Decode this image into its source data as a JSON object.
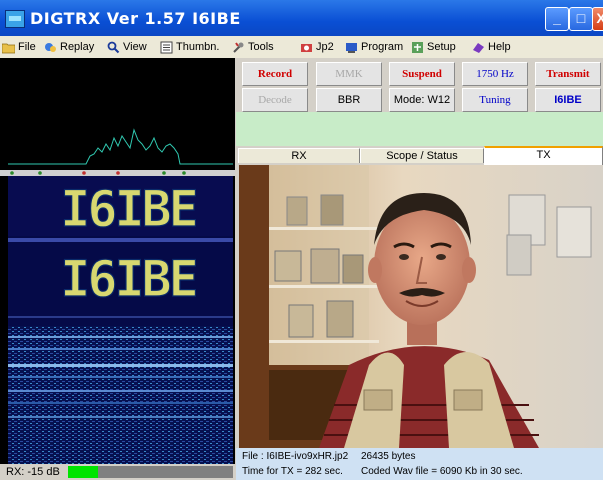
{
  "window": {
    "title": "DIGTRX  Ver 1.57     I6IBE",
    "controls": [
      "_",
      "□",
      "X"
    ]
  },
  "menu": [
    {
      "label": "File",
      "icon": "folder-icon"
    },
    {
      "label": "Replay",
      "icon": "replay-icon"
    },
    {
      "label": "View",
      "icon": "magnifier-icon"
    },
    {
      "label": "Thumbn.",
      "icon": "thumbnail-icon"
    },
    {
      "label": "Tools",
      "icon": "tools-icon"
    },
    {
      "label": "Jp2",
      "icon": "jp2-icon"
    },
    {
      "label": "Program",
      "icon": "program-icon"
    },
    {
      "label": "Setup",
      "icon": "setup-icon"
    },
    {
      "label": "Help",
      "icon": "help-icon"
    }
  ],
  "buttons": {
    "record": "Record",
    "mmk": "MMK",
    "suspend": "Suspend",
    "freq": "1750 Hz",
    "transmit": "Transmit",
    "decode": "Decode",
    "bbr": "BBR",
    "mode": "Mode: W12",
    "tuning": "Tuning",
    "callsign": "I6IBE"
  },
  "tabs": [
    "RX",
    "Scope / Status",
    "TX"
  ],
  "active_tab": "TX",
  "file_info": {
    "file": "File : I6IBE-ivo9xHR.jp2",
    "bytes": "26435 bytes",
    "tx_time": "Time for TX = 282 sec.",
    "coded": "Coded Wav file = 6090 Kb in 30 sec."
  },
  "rx": {
    "label": "RX:  -15 dB",
    "level_fraction": 0.18
  },
  "waterfall_text": "I6IBE",
  "colors": {
    "titlebar": "#0a4fd4",
    "record_red": "#d00000",
    "callsign_blue": "#0000c8",
    "rx_level": "#00e400",
    "panel_green": "#c8ecc8"
  }
}
